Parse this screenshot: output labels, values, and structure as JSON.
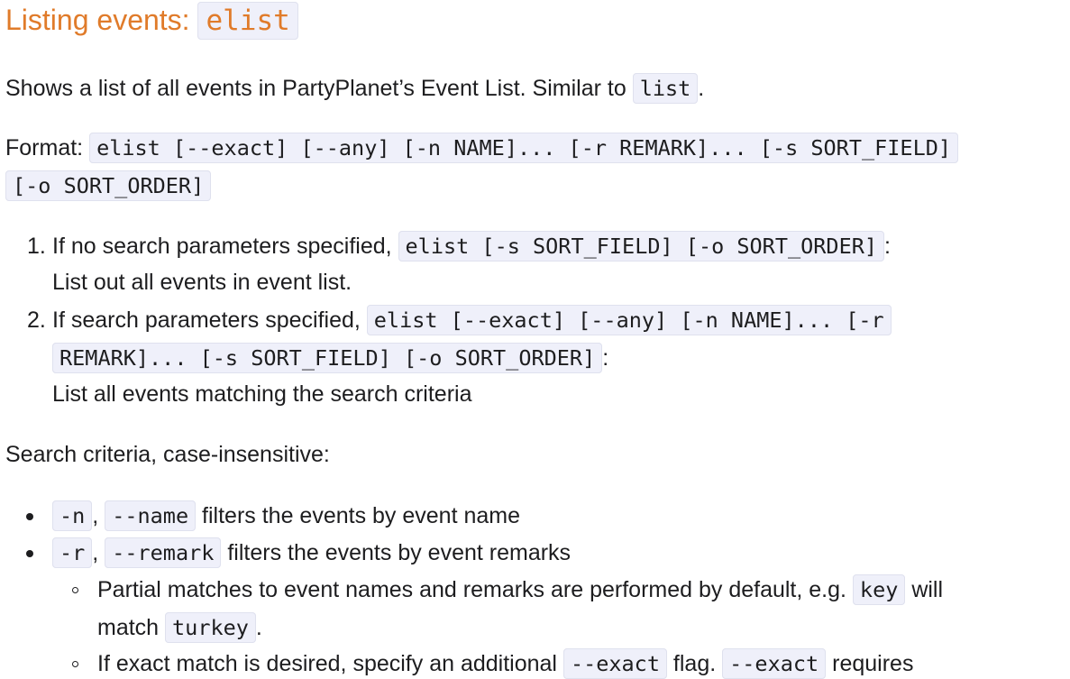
{
  "heading": {
    "text": "Listing events: ",
    "code": "elist"
  },
  "intro": {
    "text": "Shows a list of all events in PartyPlanet’s Event List. Similar to ",
    "code": "list",
    "after": "."
  },
  "format": {
    "label": "Format: ",
    "code_line1": "elist [--exact] [--any] [-n NAME]... [-r REMARK]... [-s SORT_FIELD]",
    "code_line2": "[-o SORT_ORDER]"
  },
  "ordered_list": [
    {
      "marker": "1.",
      "text": "If no search parameters specified, ",
      "code": "elist [-s SORT_FIELD] [-o SORT_ORDER]",
      "after": ":",
      "desc": "List out all events in event list."
    },
    {
      "marker": "2.",
      "text": "If search parameters specified, ",
      "code_line1": "elist [--exact] [--any] [-n NAME]... [-r",
      "code_line2": "REMARK]... [-s SORT_FIELD] [-o SORT_ORDER]",
      "after": ":",
      "desc": "List all events matching the search criteria"
    }
  ],
  "criteria_intro": "Search criteria, case-insensitive:",
  "bullets": [
    {
      "code_a": "-n",
      "sep": ", ",
      "code_b": "--name",
      "text": " filters the events by event name"
    },
    {
      "code_a": "-r",
      "sep": ", ",
      "code_b": "--remark",
      "text": " filters the events by event remarks"
    }
  ],
  "sub_bullets": [
    {
      "text_a": "Partial matches to event names and remarks are performed by default, e.g. ",
      "code_a": "key",
      "text_b": " will",
      "line2_text": "match ",
      "line2_code": "turkey",
      "line2_after": "."
    },
    {
      "text_a": "If exact match is desired, specify an additional ",
      "code_a": "--exact",
      "text_b": " flag. ",
      "code_b": "--exact",
      "text_c": " requires"
    }
  ]
}
